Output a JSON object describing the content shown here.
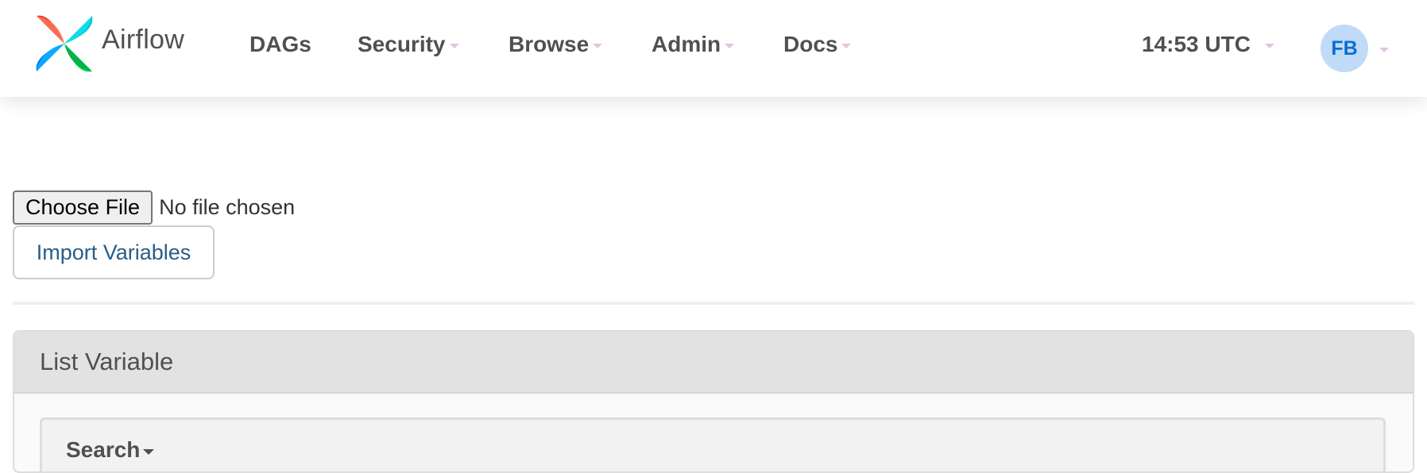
{
  "navbar": {
    "brand": "Airflow",
    "items": [
      {
        "label": "DAGs",
        "dropdown": false
      },
      {
        "label": "Security",
        "dropdown": true
      },
      {
        "label": "Browse",
        "dropdown": true
      },
      {
        "label": "Admin",
        "dropdown": true
      },
      {
        "label": "Docs",
        "dropdown": true
      }
    ],
    "clock": "14:53 UTC",
    "user_initials": "FB"
  },
  "import_form": {
    "choose_file_label": "Choose File",
    "file_status": "No file chosen",
    "import_button_label": "Import Variables"
  },
  "list_panel": {
    "title": "List Variable",
    "search_label": "Search"
  },
  "colors": {
    "text": "#51504f",
    "caret_light": "#e2c4e0",
    "avatar_bg": "#bfdbf7",
    "avatar_text": "#0a6ed1",
    "import_btn_text": "#2a5d86",
    "panel_heading_bg": "#e2e2e2",
    "logo_red": "#e43921",
    "logo_teal": "#00c7d4",
    "logo_green": "#04d659",
    "logo_blue": "#017cee"
  },
  "icons": [
    "airflow-logo-icon",
    "caret-down-icon",
    "user-avatar"
  ]
}
